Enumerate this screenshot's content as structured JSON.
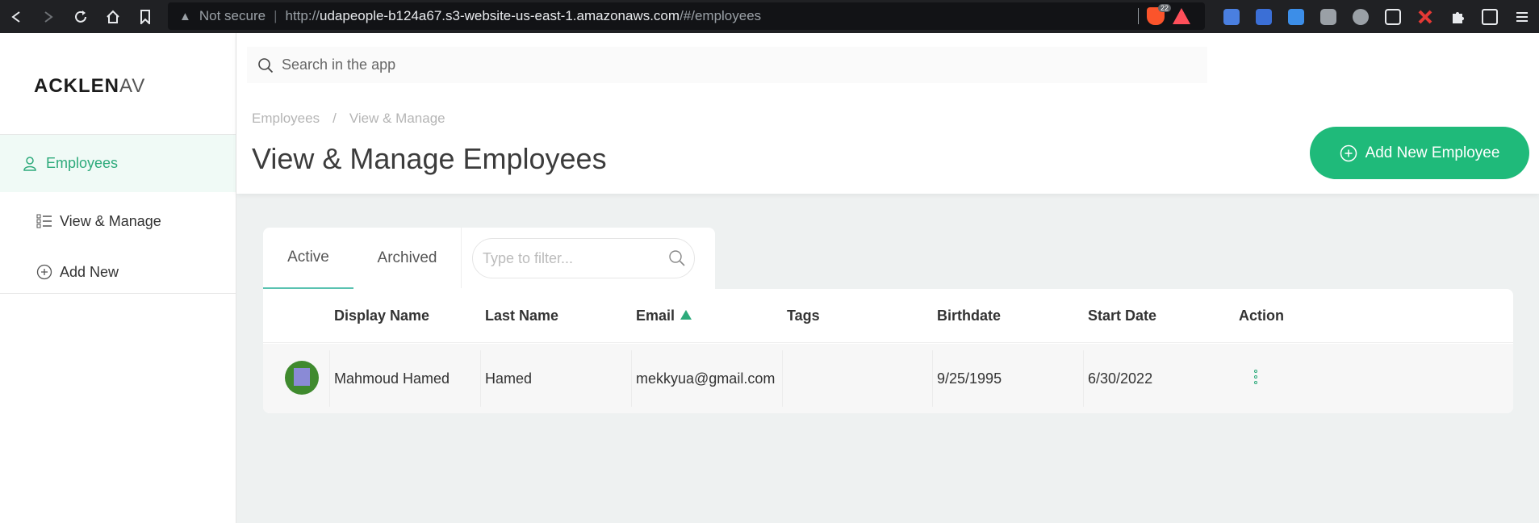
{
  "browser": {
    "not_secure": "Not secure",
    "url_proto": "http://",
    "url_host": "udapeople-b124a67.s3-website-us-east-1.amazonaws.com",
    "url_path": "/#/employees",
    "brave_badge": "22"
  },
  "sidebar": {
    "logo_bold": "ACKLEN",
    "logo_light": "AV",
    "items": [
      {
        "label": "Employees",
        "icon": "user-icon"
      },
      {
        "label": "View & Manage",
        "icon": "list-icon"
      },
      {
        "label": "Add New",
        "icon": "plus-circle-icon"
      }
    ]
  },
  "header": {
    "search_placeholder": "Search in the app",
    "breadcrumb": [
      "Employees",
      "/",
      "View & Manage"
    ],
    "title": "View & Manage Employees",
    "add_button_label": "Add New Employee"
  },
  "tabs": {
    "items": [
      "Active",
      "Archived"
    ],
    "filter_placeholder": "Type to filter..."
  },
  "table": {
    "columns": [
      "Display Name",
      "Last Name",
      "Email",
      "Tags",
      "Birthdate",
      "Start Date",
      "Action"
    ],
    "rows": [
      {
        "display_name": "Mahmoud Hamed",
        "last_name": "Hamed",
        "email": "mekkyua@gmail.com",
        "tags": "",
        "birthdate": "9/25/1995",
        "start_date": "6/30/2022"
      }
    ]
  },
  "colors": {
    "accent": "#1fba7a",
    "active_nav": "#2daa7b"
  }
}
